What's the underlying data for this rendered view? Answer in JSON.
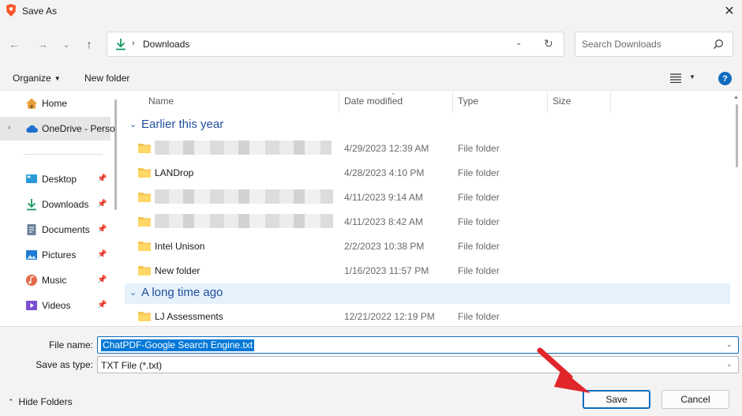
{
  "window": {
    "title": "Save As",
    "close_glyph": "✕"
  },
  "nav": {
    "back_glyph": "←",
    "forward_glyph": "→",
    "recent_glyph": "⌄",
    "up_glyph": "↑",
    "address": {
      "separator": "›",
      "current": "Downloads",
      "dropdown_glyph": "⌄",
      "refresh_glyph": "↻"
    },
    "search": {
      "placeholder": "Search Downloads"
    }
  },
  "commands": {
    "organize": "Organize",
    "organize_arrow": "▼",
    "new_folder": "New folder",
    "view_dd": "▼",
    "help": "?"
  },
  "sidebar": {
    "items": [
      {
        "label": "Home",
        "icon": "home-icon"
      },
      {
        "label": "OneDrive - Perso",
        "icon": "cloud-icon",
        "selected": true,
        "chevron": "›"
      },
      {
        "label": "Desktop",
        "icon": "desktop-icon",
        "pin": "📌"
      },
      {
        "label": "Downloads",
        "icon": "download-icon",
        "pin": "📌"
      },
      {
        "label": "Documents",
        "icon": "documents-icon",
        "pin": "📌"
      },
      {
        "label": "Pictures",
        "icon": "pictures-icon",
        "pin": "📌"
      },
      {
        "label": "Music",
        "icon": "music-icon",
        "pin": "📌"
      },
      {
        "label": "Videos",
        "icon": "videos-icon",
        "pin": "📌"
      }
    ]
  },
  "list": {
    "columns": {
      "name": "Name",
      "date": "Date modified",
      "type": "Type",
      "size": "Size",
      "sort_glyph": "⌄"
    },
    "groups": [
      {
        "label": "Earlier this year",
        "chevron": "⌄"
      },
      {
        "label": "A long time ago",
        "chevron": "⌄"
      }
    ],
    "rows": [
      {
        "name": "",
        "redacted": true,
        "date": "4/29/2023 12:39 AM",
        "type": "File folder"
      },
      {
        "name": "LANDrop",
        "date": "4/28/2023 4:10 PM",
        "type": "File folder"
      },
      {
        "name": "",
        "redacted": true,
        "date": "4/11/2023 9:14 AM",
        "type": "File folder"
      },
      {
        "name": "",
        "redacted": true,
        "date": "4/11/2023 8:42 AM",
        "type": "File folder"
      },
      {
        "name": "Intel Unison",
        "date": "2/2/2023 10:38 PM",
        "type": "File folder"
      },
      {
        "name": "New folder",
        "date": "1/16/2023 11:57 PM",
        "type": "File folder"
      },
      {
        "name": "LJ Assessments",
        "date": "12/21/2022 12:19 PM",
        "type": "File folder"
      }
    ]
  },
  "form": {
    "file_name_label": "File name:",
    "file_name_value": "ChatPDF-Google Search Engine.txt",
    "save_type_label": "Save as type:",
    "save_type_value": "TXT File (*.txt)",
    "dropdown_glyph": "⌄"
  },
  "footer": {
    "hide_folders": "Hide Folders",
    "hide_chevron": "⌃",
    "save": "Save",
    "cancel": "Cancel"
  },
  "colors": {
    "accent": "#0f6cbd",
    "folder": "#f4c34f",
    "arrow": "#e0262b",
    "group_text": "#1e4e9b"
  }
}
